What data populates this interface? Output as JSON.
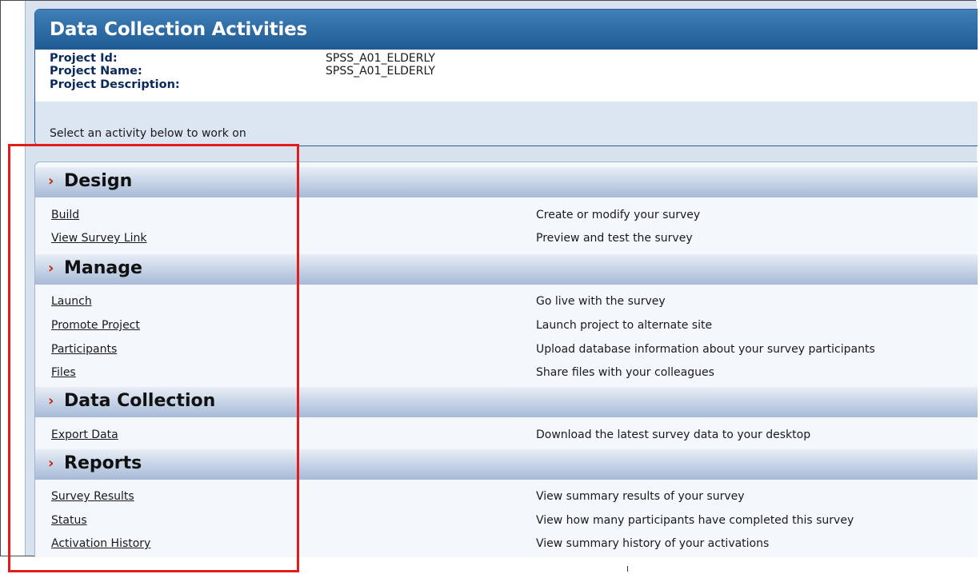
{
  "title": "Data Collection Activities",
  "project": {
    "id_label": "Project Id:",
    "id_value": "SPSS_A01_ELDERLY",
    "name_label": "Project Name:",
    "name_value": "SPSS_A01_ELDERLY",
    "description_label": "Project Description:",
    "description_value": ""
  },
  "instruction": "Select an activity below to work on",
  "chevron": "›",
  "sections": [
    {
      "title": "Design",
      "items": [
        {
          "label": "Build",
          "description": "Create or modify your survey"
        },
        {
          "label": "View Survey Link",
          "description": "Preview and test the survey"
        }
      ]
    },
    {
      "title": "Manage",
      "items": [
        {
          "label": "Launch",
          "description": "Go live with the survey"
        },
        {
          "label": "Promote Project",
          "description": "Launch project to alternate site"
        },
        {
          "label": "Participants",
          "description": "Upload database information about your survey participants"
        },
        {
          "label": "Files",
          "description": "Share files with your colleagues"
        }
      ]
    },
    {
      "title": "Data Collection",
      "items": [
        {
          "label": "Export Data",
          "description": "Download the latest survey data to your desktop"
        }
      ]
    },
    {
      "title": "Reports",
      "items": [
        {
          "label": "Survey Results",
          "description": "View summary results of your survey"
        },
        {
          "label": "Status",
          "description": "View how many participants have completed this survey"
        },
        {
          "label": "Activation History",
          "description": "View summary history of your activations"
        }
      ]
    }
  ],
  "colors": {
    "header_blue": "#1f5a93",
    "section_chevron": "#cc2200",
    "highlight_red": "#e21b1b"
  }
}
